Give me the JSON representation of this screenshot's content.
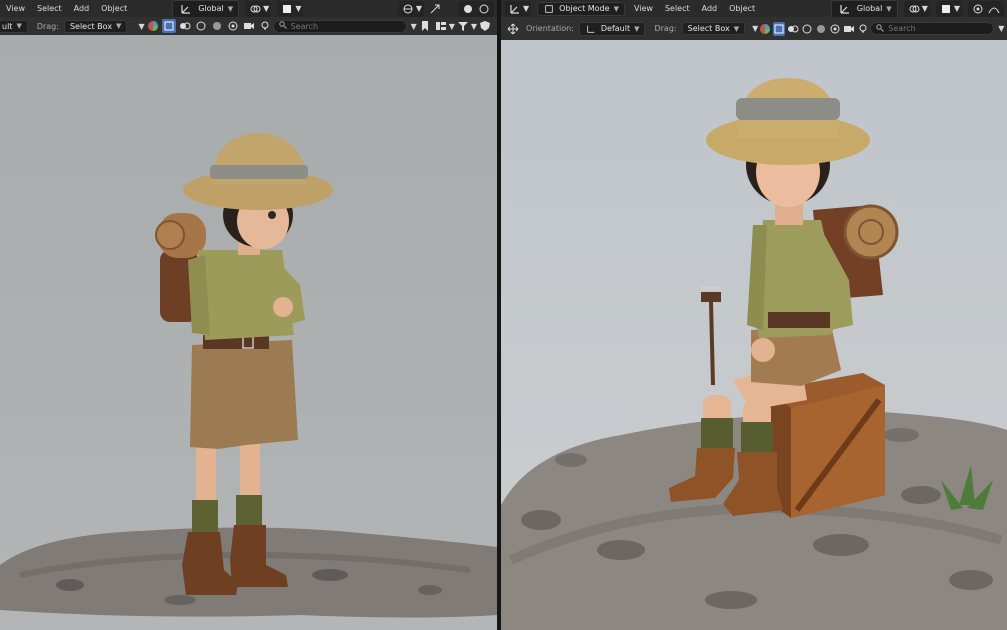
{
  "left": {
    "menu": [
      "View",
      "Select",
      "Add",
      "Object"
    ],
    "transform_orientation": "Global",
    "mode_value": "ult",
    "drag_label": "Drag:",
    "drag_value": "Select Box",
    "search_placeholder": "Search"
  },
  "right": {
    "mode": "Object Mode",
    "menu": [
      "View",
      "Select",
      "Add",
      "Object"
    ],
    "transform_orientation": "Global",
    "orientation_label": "Orientation:",
    "orientation_value": "Default",
    "drag_label": "Drag:",
    "drag_value": "Select Box",
    "search_placeholder": "Search"
  },
  "colors": {
    "header": "#2b2b2b",
    "subheader": "#303030",
    "selected_accent": "#4772b3",
    "viewport_left": "#aeb1b2",
    "viewport_right": "#c6cacd"
  },
  "icons": [
    "transform-orientation-icon",
    "pivot-point-icon",
    "snap-icon",
    "proportional-edit-icon",
    "select-mode-icon",
    "filter-icon",
    "bookmark-icon",
    "shield-icon",
    "move-gizmo-icon",
    "editor-type-icon"
  ]
}
